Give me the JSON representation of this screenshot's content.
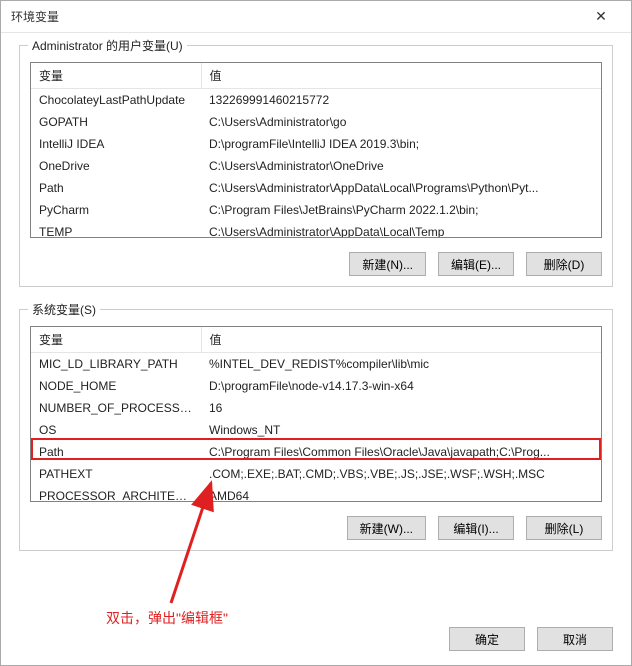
{
  "window": {
    "title": "环境变量",
    "close_glyph": "✕"
  },
  "user_group": {
    "label": "Administrator 的用户变量(U)",
    "header_name": "变量",
    "header_value": "值",
    "rows": [
      {
        "name": "ChocolateyLastPathUpdate",
        "value": "132269991460215772"
      },
      {
        "name": "GOPATH",
        "value": "C:\\Users\\Administrator\\go"
      },
      {
        "name": "IntelliJ IDEA",
        "value": "D:\\programFile\\IntelliJ IDEA 2019.3\\bin;"
      },
      {
        "name": "OneDrive",
        "value": "C:\\Users\\Administrator\\OneDrive"
      },
      {
        "name": "Path",
        "value": "C:\\Users\\Administrator\\AppData\\Local\\Programs\\Python\\Pyt..."
      },
      {
        "name": "PyCharm",
        "value": "C:\\Program Files\\JetBrains\\PyCharm 2022.1.2\\bin;"
      },
      {
        "name": "TEMP",
        "value": "C:\\Users\\Administrator\\AppData\\Local\\Temp"
      }
    ],
    "btn_new": "新建(N)...",
    "btn_edit": "编辑(E)...",
    "btn_delete": "删除(D)"
  },
  "sys_group": {
    "label": "系统变量(S)",
    "header_name": "变量",
    "header_value": "值",
    "rows": [
      {
        "name": "MIC_LD_LIBRARY_PATH",
        "value": "%INTEL_DEV_REDIST%compiler\\lib\\mic"
      },
      {
        "name": "NODE_HOME",
        "value": "D:\\programFile\\node-v14.17.3-win-x64"
      },
      {
        "name": "NUMBER_OF_PROCESSORS",
        "value": "16"
      },
      {
        "name": "OS",
        "value": "Windows_NT"
      },
      {
        "name": "Path",
        "value": "C:\\Program Files\\Common Files\\Oracle\\Java\\javapath;C:\\Prog..."
      },
      {
        "name": "PATHEXT",
        "value": ".COM;.EXE;.BAT;.CMD;.VBS;.VBE;.JS;.JSE;.WSF;.WSH;.MSC"
      },
      {
        "name": "PROCESSOR_ARCHITECT...",
        "value": "AMD64"
      }
    ],
    "btn_new": "新建(W)...",
    "btn_edit": "编辑(I)...",
    "btn_delete": "删除(L)"
  },
  "footer": {
    "ok": "确定",
    "cancel": "取消"
  },
  "annotation": {
    "text": "双击，弹出\"编辑框\""
  }
}
